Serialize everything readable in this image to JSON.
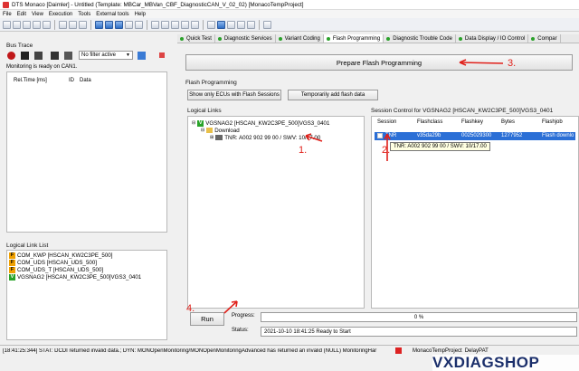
{
  "window": {
    "title": "DTS Monaco [Daimler] - Untitled (Template: MBCar_MBVan_CBF_DiagnosticCAN_V_02_02) [MonacoTempProject]"
  },
  "menu": [
    "File",
    "Edit",
    "View",
    "Execution",
    "Tools",
    "External tools",
    "Help"
  ],
  "bus_trace": {
    "title": "Bus Trace",
    "filter_value": "No filter active",
    "status": "Monitoring is ready on CAN1.",
    "columns": [
      "Rel.Time [ms]",
      "ID",
      "Data"
    ]
  },
  "logical_link_list": {
    "title": "Logical Link List",
    "items": [
      {
        "badge": "F",
        "label": "COM_KWP [HSCAN_KW2C3PE_500]"
      },
      {
        "badge": "F",
        "label": "COM_UDS [HSCAN_UDS_500]"
      },
      {
        "badge": "F",
        "label": "COM_UDS_T [HSCAN_UDS_500]"
      },
      {
        "badge": "V",
        "label": "VGSNAG2 [HSCAN_KW2C3PE_500]VGS3_0401"
      }
    ]
  },
  "tabs": [
    {
      "label": "Quick Test",
      "active": false
    },
    {
      "label": "Diagnostic Services",
      "active": false
    },
    {
      "label": "Variant Coding",
      "active": false
    },
    {
      "label": "Flash Programming",
      "active": true
    },
    {
      "label": "Diagnostic Trouble Code",
      "active": false
    },
    {
      "label": "Data Display / IO Control",
      "active": false
    },
    {
      "label": "Compar",
      "active": false
    }
  ],
  "flash": {
    "prepare_button": "Prepare Flash Programming",
    "section_title": "Flash Programming",
    "show_only_button": "Show only ECUs with Flash Sessions",
    "temp_add_button": "Temporarily add flash data",
    "logical_links_title": "Logical Links",
    "tree": {
      "root": "VGSNAG2 [HSCAN_KW2C3PE_500]VGS3_0401",
      "download": "Download",
      "entry": "TNR: A002 902 99 00 / SWV: 10/17.00"
    },
    "session_control_title": "Session Control for VGSNAG2 [HSCAN_KW2C3PE_500]VGS3_0401",
    "columns": [
      "Session",
      "Flashclass",
      "Flashkey",
      "Bytes",
      "Flashjob"
    ],
    "row": {
      "session": "TNR",
      "flashclass": "v35da29b",
      "flashkey": "0025029300",
      "bytes": "1277952",
      "flashjob": "Flash downlo"
    },
    "tooltip": "TNR: A002 902 99 00 / SWV: 10/17.00",
    "run_button": "Run",
    "progress_label": "Progress:",
    "progress_text": "0 %",
    "progress_fraction": 0,
    "status_label": "Status:",
    "status_text": "2021-10-10 18:41:25  Ready to Start"
  },
  "annotations": {
    "a1": "1.",
    "a2": "2.",
    "a3": "3.",
    "a4": "4."
  },
  "statusbar": {
    "message": "[18:41:25:344] STAT: DCDI returned invalid data.; DYN: MONOpenMonitoring/MONOpenMonitoringAdvanced has returned an invalid (NULL) MonitoringHar",
    "project": "MonacoTempProject",
    "delay": "DelayPAT"
  },
  "watermark": "VXDIAGSHOP"
}
